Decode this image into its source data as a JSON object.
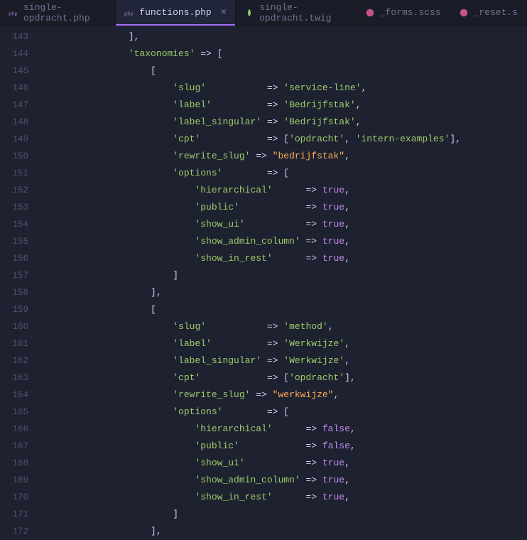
{
  "tabs": [
    {
      "label": "single-opdracht.php",
      "icon": "php-icon",
      "active": false
    },
    {
      "label": "functions.php",
      "icon": "php-icon",
      "active": true,
      "closeable": true
    },
    {
      "label": "single-opdracht.twig",
      "icon": "twig-icon",
      "active": false
    },
    {
      "label": "_forms.scss",
      "icon": "scss-icon",
      "active": false
    },
    {
      "label": "_reset.s",
      "icon": "scss-icon",
      "active": false
    }
  ],
  "first_line_no": 143,
  "code_lines": [
    {
      "tokens": [
        {
          "t": "                ],",
          "c": "p"
        }
      ]
    },
    {
      "tokens": [
        {
          "t": "                ",
          "c": "p"
        },
        {
          "t": "'taxonomies'",
          "c": "s"
        },
        {
          "t": " => [",
          "c": "p"
        }
      ]
    },
    {
      "tokens": [
        {
          "t": "                    [",
          "c": "p"
        }
      ]
    },
    {
      "tokens": [
        {
          "t": "                        ",
          "c": "p"
        },
        {
          "t": "'slug'",
          "c": "s"
        },
        {
          "t": "           => ",
          "c": "p"
        },
        {
          "t": "'service-line'",
          "c": "s"
        },
        {
          "t": ",",
          "c": "p"
        }
      ]
    },
    {
      "tokens": [
        {
          "t": "                        ",
          "c": "p"
        },
        {
          "t": "'label'",
          "c": "s"
        },
        {
          "t": "          => ",
          "c": "p"
        },
        {
          "t": "'Bedrijfstak'",
          "c": "s"
        },
        {
          "t": ",",
          "c": "p"
        }
      ]
    },
    {
      "tokens": [
        {
          "t": "                        ",
          "c": "p"
        },
        {
          "t": "'label_singular'",
          "c": "s"
        },
        {
          "t": " => ",
          "c": "p"
        },
        {
          "t": "'Bedrijfstak'",
          "c": "s"
        },
        {
          "t": ",",
          "c": "p"
        }
      ]
    },
    {
      "tokens": [
        {
          "t": "                        ",
          "c": "p"
        },
        {
          "t": "'cpt'",
          "c": "s"
        },
        {
          "t": "            => [",
          "c": "p"
        },
        {
          "t": "'opdracht'",
          "c": "s"
        },
        {
          "t": ", ",
          "c": "p"
        },
        {
          "t": "'intern-examples'",
          "c": "s"
        },
        {
          "t": "],",
          "c": "p"
        }
      ]
    },
    {
      "tokens": [
        {
          "t": "                        ",
          "c": "p"
        },
        {
          "t": "'rewrite_slug'",
          "c": "s"
        },
        {
          "t": " => ",
          "c": "p"
        },
        {
          "t": "\"bedrijfstak\"",
          "c": "d"
        },
        {
          "t": ",",
          "c": "p"
        }
      ]
    },
    {
      "tokens": [
        {
          "t": "                        ",
          "c": "p"
        },
        {
          "t": "'options'",
          "c": "s"
        },
        {
          "t": "        => [",
          "c": "p"
        }
      ]
    },
    {
      "tokens": [
        {
          "t": "                            ",
          "c": "p"
        },
        {
          "t": "'hierarchical'",
          "c": "s"
        },
        {
          "t": "      => ",
          "c": "p"
        },
        {
          "t": "true",
          "c": "kw"
        },
        {
          "t": ",",
          "c": "p"
        }
      ]
    },
    {
      "tokens": [
        {
          "t": "                            ",
          "c": "p"
        },
        {
          "t": "'public'",
          "c": "s"
        },
        {
          "t": "            => ",
          "c": "p"
        },
        {
          "t": "true",
          "c": "kw"
        },
        {
          "t": ",",
          "c": "p"
        }
      ]
    },
    {
      "tokens": [
        {
          "t": "                            ",
          "c": "p"
        },
        {
          "t": "'show_ui'",
          "c": "s"
        },
        {
          "t": "           => ",
          "c": "p"
        },
        {
          "t": "true",
          "c": "kw"
        },
        {
          "t": ",",
          "c": "p"
        }
      ]
    },
    {
      "tokens": [
        {
          "t": "                            ",
          "c": "p"
        },
        {
          "t": "'show_admin_column'",
          "c": "s"
        },
        {
          "t": " => ",
          "c": "p"
        },
        {
          "t": "true",
          "c": "kw"
        },
        {
          "t": ",",
          "c": "p"
        }
      ]
    },
    {
      "tokens": [
        {
          "t": "                            ",
          "c": "p"
        },
        {
          "t": "'show_in_rest'",
          "c": "s"
        },
        {
          "t": "      => ",
          "c": "p"
        },
        {
          "t": "true",
          "c": "kw"
        },
        {
          "t": ",",
          "c": "p"
        }
      ]
    },
    {
      "tokens": [
        {
          "t": "                        ]",
          "c": "p"
        }
      ]
    },
    {
      "tokens": [
        {
          "t": "                    ],",
          "c": "p"
        }
      ]
    },
    {
      "tokens": [
        {
          "t": "                    [",
          "c": "p"
        }
      ]
    },
    {
      "tokens": [
        {
          "t": "                        ",
          "c": "p"
        },
        {
          "t": "'slug'",
          "c": "s"
        },
        {
          "t": "           => ",
          "c": "p"
        },
        {
          "t": "'method'",
          "c": "s"
        },
        {
          "t": ",",
          "c": "p"
        }
      ]
    },
    {
      "tokens": [
        {
          "t": "                        ",
          "c": "p"
        },
        {
          "t": "'label'",
          "c": "s"
        },
        {
          "t": "          => ",
          "c": "p"
        },
        {
          "t": "'Werkwijze'",
          "c": "s"
        },
        {
          "t": ",",
          "c": "p"
        }
      ]
    },
    {
      "tokens": [
        {
          "t": "                        ",
          "c": "p"
        },
        {
          "t": "'label_singular'",
          "c": "s"
        },
        {
          "t": " => ",
          "c": "p"
        },
        {
          "t": "'Werkwijze'",
          "c": "s"
        },
        {
          "t": ",",
          "c": "p"
        }
      ]
    },
    {
      "tokens": [
        {
          "t": "                        ",
          "c": "p"
        },
        {
          "t": "'cpt'",
          "c": "s"
        },
        {
          "t": "            => [",
          "c": "p"
        },
        {
          "t": "'opdracht'",
          "c": "s"
        },
        {
          "t": "],",
          "c": "p"
        }
      ]
    },
    {
      "tokens": [
        {
          "t": "                        ",
          "c": "p"
        },
        {
          "t": "'rewrite_slug'",
          "c": "s"
        },
        {
          "t": " => ",
          "c": "p"
        },
        {
          "t": "\"werkwijze\"",
          "c": "d"
        },
        {
          "t": ",",
          "c": "p"
        }
      ]
    },
    {
      "tokens": [
        {
          "t": "                        ",
          "c": "p"
        },
        {
          "t": "'options'",
          "c": "s"
        },
        {
          "t": "        => [",
          "c": "p"
        }
      ]
    },
    {
      "tokens": [
        {
          "t": "                            ",
          "c": "p"
        },
        {
          "t": "'hierarchical'",
          "c": "s"
        },
        {
          "t": "      => ",
          "c": "p"
        },
        {
          "t": "false",
          "c": "kw"
        },
        {
          "t": ",",
          "c": "p"
        }
      ]
    },
    {
      "tokens": [
        {
          "t": "                            ",
          "c": "p"
        },
        {
          "t": "'public'",
          "c": "s"
        },
        {
          "t": "            => ",
          "c": "p"
        },
        {
          "t": "false",
          "c": "kw"
        },
        {
          "t": ",",
          "c": "p"
        }
      ]
    },
    {
      "tokens": [
        {
          "t": "                            ",
          "c": "p"
        },
        {
          "t": "'show_ui'",
          "c": "s"
        },
        {
          "t": "           => ",
          "c": "p"
        },
        {
          "t": "true",
          "c": "kw"
        },
        {
          "t": ",",
          "c": "p"
        }
      ]
    },
    {
      "tokens": [
        {
          "t": "                            ",
          "c": "p"
        },
        {
          "t": "'show_admin_column'",
          "c": "s"
        },
        {
          "t": " => ",
          "c": "p"
        },
        {
          "t": "true",
          "c": "kw"
        },
        {
          "t": ",",
          "c": "p"
        }
      ]
    },
    {
      "tokens": [
        {
          "t": "                            ",
          "c": "p"
        },
        {
          "t": "'show_in_rest'",
          "c": "s"
        },
        {
          "t": "      => ",
          "c": "p"
        },
        {
          "t": "true",
          "c": "kw"
        },
        {
          "t": ",",
          "c": "p"
        }
      ]
    },
    {
      "tokens": [
        {
          "t": "                        ]",
          "c": "p"
        }
      ]
    },
    {
      "tokens": [
        {
          "t": "                    ],",
          "c": "p"
        }
      ]
    }
  ]
}
